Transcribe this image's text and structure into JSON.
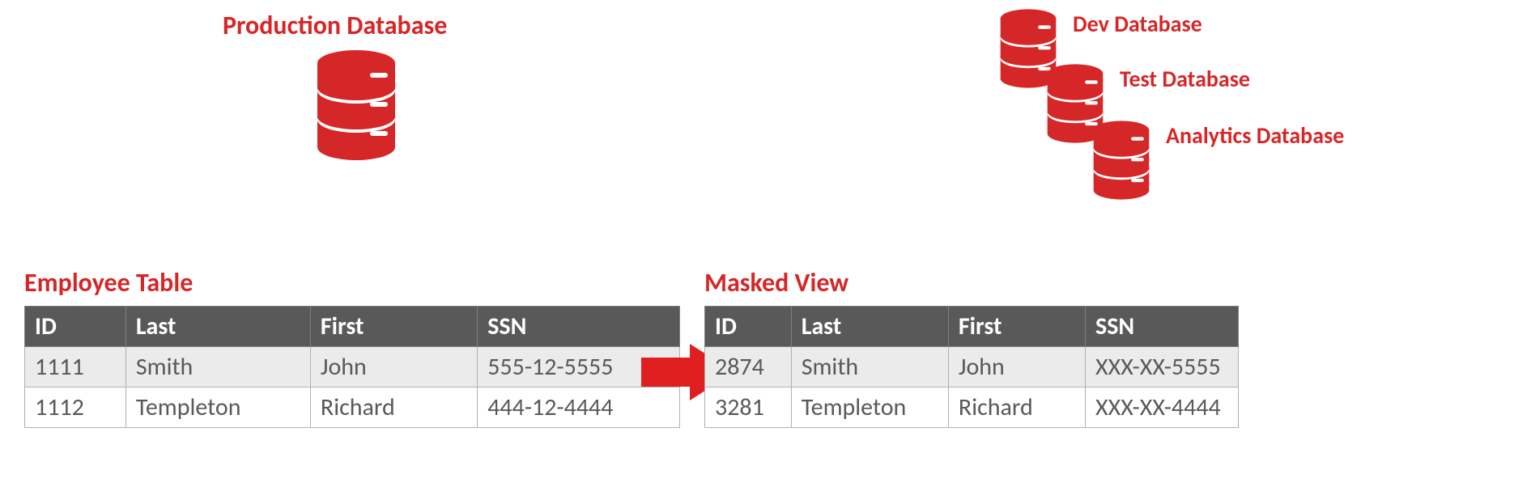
{
  "prod_label": "Production Database",
  "db_labels": {
    "dev": "Dev Database",
    "test": "Test Database",
    "analytics": "Analytics Database"
  },
  "left_title": "Employee Table",
  "right_title": "Masked View",
  "headers": {
    "id": "ID",
    "last": "Last",
    "first": "First",
    "ssn": "SSN"
  },
  "employee_rows": [
    {
      "id": "1111",
      "last": "Smith",
      "first": "John",
      "ssn": "555-12-5555"
    },
    {
      "id": "1112",
      "last": "Templeton",
      "first": "Richard",
      "ssn": "444-12-4444"
    }
  ],
  "masked_rows": [
    {
      "id": "2874",
      "last": "Smith",
      "first": "John",
      "ssn": "XXX-XX-5555"
    },
    {
      "id": "3281",
      "last": "Templeton",
      "first": "Richard",
      "ssn": "XXX-XX-4444"
    }
  ],
  "colors": {
    "brand": "#d62728"
  }
}
